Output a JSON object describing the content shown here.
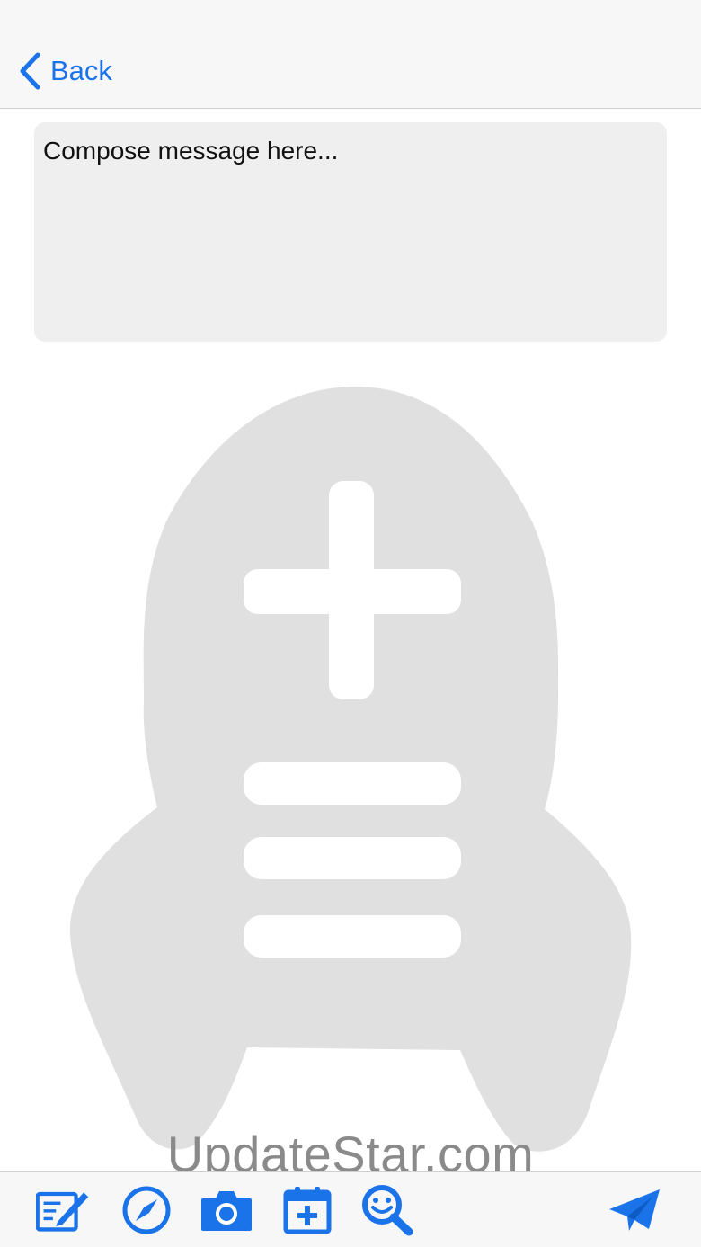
{
  "nav": {
    "back_label": "Back"
  },
  "composer": {
    "placeholder": "Compose message here..."
  },
  "watermark": {
    "text": "UpdateStar.com"
  },
  "toolbar": {
    "icons": [
      "edit-note-icon",
      "compass-icon",
      "camera-icon",
      "calendar-add-icon",
      "emoji-search-icon",
      "send-icon"
    ]
  },
  "colors": {
    "accent": "#1a73e8",
    "navbar_bg": "#f7f7f7",
    "compose_bg": "#efefef",
    "illustration": "#e0e0e0"
  }
}
